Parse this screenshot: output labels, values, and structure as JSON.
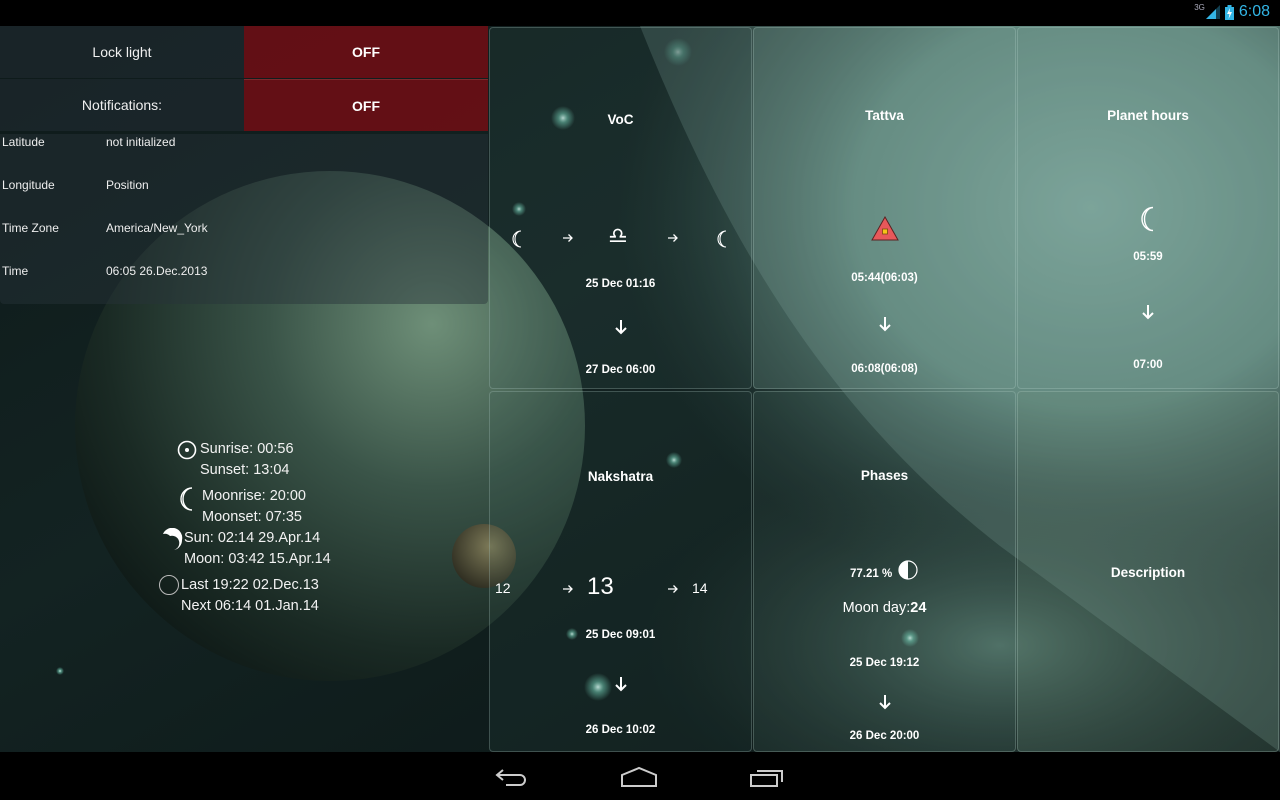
{
  "status_bar": {
    "network_label": "3G",
    "signal_icon": "signal-icon",
    "battery_icon": "battery-charging-icon",
    "time": "6:08",
    "accent_color": "#33b5e5"
  },
  "settings": {
    "lock_light": {
      "label": "Lock light",
      "value": "OFF"
    },
    "notifications": {
      "label": "Notifications:",
      "value": "OFF"
    },
    "toggle_off_color": "#6e0e14"
  },
  "location": [
    {
      "key": "Latitude",
      "value": "not initialized"
    },
    {
      "key": "Longitude",
      "value": "Position"
    },
    {
      "key": "Time Zone",
      "value": "America/New_York"
    },
    {
      "key": "Time",
      "value": "06:05 26.Dec.2013"
    }
  ],
  "astro": {
    "sun_icon": "sun-icon",
    "sunrise": "Sunrise: 00:56",
    "sunset": "Sunset: 13:04",
    "moon_icon": "crescent-moon-icon",
    "moonrise": "Moonrise: 20:00",
    "moonset": "Moonset: 07:35",
    "eclipse_icon": "eclipse-icon",
    "eclipse_sun": "Sun: 02:14 29.Apr.14",
    "eclipse_moon": "Moon: 03:42 15.Apr.14",
    "new_moon_icon": "new-moon-icon",
    "last": "Last 19:22 02.Dec.13",
    "next": "Next 06:14 01.Jan.14"
  },
  "tiles": {
    "voc": {
      "title": "VoC",
      "from_icon": "moon-icon",
      "sign_icon": "libra-icon",
      "sign_symbol": "♎",
      "to_icon": "moon-icon",
      "start": "25 Dec 01:16",
      "end": "27 Dec 06:00"
    },
    "tattva": {
      "title": "Tattva",
      "icon": "agni-triangle-icon",
      "start": "05:44(06:03)",
      "end": "06:08(06:08)",
      "icon_color": "#e8585a"
    },
    "planet_hours": {
      "title": "Planet hours",
      "icon": "moon-icon",
      "start": "05:59",
      "end": "07:00"
    },
    "nakshatra": {
      "title": "Nakshatra",
      "prev": "12",
      "current": "13",
      "next": "14",
      "start": "25 Dec 09:01",
      "end": "26 Dec 10:02"
    },
    "phases": {
      "title": "Phases",
      "illumination": "77.21 %",
      "phase_icon": "moon-phase-icon",
      "moon_day_label": "Moon day:",
      "moon_day_value": "24",
      "start": "25 Dec 19:12",
      "end": "26 Dec 20:00"
    },
    "description": {
      "title": "Description"
    }
  },
  "nav_bar": {
    "back": "back-icon",
    "home": "home-icon",
    "recents": "recent-apps-icon"
  }
}
